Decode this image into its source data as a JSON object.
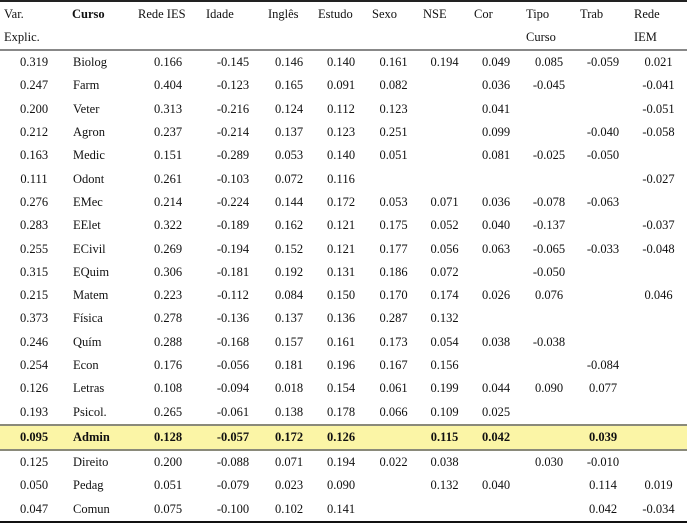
{
  "table": {
    "headers": [
      {
        "line1": "Var.",
        "line2": "Explic."
      },
      {
        "line1": "Curso",
        "line2": ""
      },
      {
        "line1": "Rede IES",
        "line2": ""
      },
      {
        "line1": "Idade",
        "line2": ""
      },
      {
        "line1": "Inglês",
        "line2": ""
      },
      {
        "line1": "Estudo",
        "line2": ""
      },
      {
        "line1": "Sexo",
        "line2": ""
      },
      {
        "line1": "NSE",
        "line2": ""
      },
      {
        "line1": "Cor",
        "line2": ""
      },
      {
        "line1": "Tipo",
        "line2": "Curso"
      },
      {
        "line1": "Trab",
        "line2": ""
      },
      {
        "line1": "Rede",
        "line2": "IEM"
      }
    ],
    "highlight_row_index": 16,
    "highlight_color": "#fbf5a6",
    "rows": [
      [
        "0.319",
        "Biolog",
        "0.166",
        "-0.145",
        "0.146",
        "0.140",
        "0.161",
        "0.194",
        "0.049",
        "0.085",
        "-0.059",
        "0.021"
      ],
      [
        "0.247",
        "Farm",
        "0.404",
        "-0.123",
        "0.165",
        "0.091",
        "0.082",
        "",
        "0.036",
        "-0.045",
        "",
        "-0.041"
      ],
      [
        "0.200",
        "Veter",
        "0.313",
        "-0.216",
        "0.124",
        "0.112",
        "0.123",
        "",
        "0.041",
        "",
        "",
        "-0.051"
      ],
      [
        "0.212",
        "Agron",
        "0.237",
        "-0.214",
        "0.137",
        "0.123",
        "0.251",
        "",
        "0.099",
        "",
        "-0.040",
        "-0.058"
      ],
      [
        "0.163",
        "Medic",
        "0.151",
        "-0.289",
        "0.053",
        "0.140",
        "0.051",
        "",
        "0.081",
        "-0.025",
        "-0.050",
        ""
      ],
      [
        "0.111",
        "Odont",
        "0.261",
        "-0.103",
        "0.072",
        "0.116",
        "",
        "",
        "",
        "",
        "",
        "-0.027"
      ],
      [
        "0.276",
        "EMec",
        "0.214",
        "-0.224",
        "0.144",
        "0.172",
        "0.053",
        "0.071",
        "0.036",
        "-0.078",
        "-0.063",
        ""
      ],
      [
        "0.283",
        "EElet",
        "0.322",
        "-0.189",
        "0.162",
        "0.121",
        "0.175",
        "0.052",
        "0.040",
        "-0.137",
        "",
        "-0.037"
      ],
      [
        "0.255",
        "ECivil",
        "0.269",
        "-0.194",
        "0.152",
        "0.121",
        "0.177",
        "0.056",
        "0.063",
        "-0.065",
        "-0.033",
        "-0.048"
      ],
      [
        "0.315",
        "EQuim",
        "0.306",
        "-0.181",
        "0.192",
        "0.131",
        "0.186",
        "0.072",
        "",
        "-0.050",
        "",
        ""
      ],
      [
        "0.215",
        "Matem",
        "0.223",
        "-0.112",
        "0.084",
        "0.150",
        "0.170",
        "0.174",
        "0.026",
        "0.076",
        "",
        "0.046"
      ],
      [
        "0.373",
        "Física",
        "0.278",
        "-0.136",
        "0.137",
        "0.136",
        "0.287",
        "0.132",
        "",
        "",
        "",
        ""
      ],
      [
        "0.246",
        "Quím",
        "0.288",
        "-0.168",
        "0.157",
        "0.161",
        "0.173",
        "0.054",
        "0.038",
        "-0.038",
        "",
        ""
      ],
      [
        "0.254",
        "Econ",
        "0.176",
        "-0.056",
        "0.181",
        "0.196",
        "0.167",
        "0.156",
        "",
        "",
        "-0.084",
        ""
      ],
      [
        "0.126",
        "Letras",
        "0.108",
        "-0.094",
        "0.018",
        "0.154",
        "0.061",
        "0.199",
        "0.044",
        "0.090",
        "0.077",
        ""
      ],
      [
        "0.193",
        "Psicol.",
        "0.265",
        "-0.061",
        "0.138",
        "0.178",
        "0.066",
        "0.109",
        "0.025",
        "",
        "",
        ""
      ],
      [
        "0.095",
        "Admin",
        "0.128",
        "-0.057",
        "0.172",
        "0.126",
        "",
        "0.115",
        "0.042",
        "",
        "0.039",
        ""
      ],
      [
        "0.125",
        "Direito",
        "0.200",
        "-0.088",
        "0.071",
        "0.194",
        "0.022",
        "0.038",
        "",
        "0.030",
        "-0.010",
        ""
      ],
      [
        "0.050",
        "Pedag",
        "0.051",
        "-0.079",
        "0.023",
        "0.090",
        "",
        "0.132",
        "0.040",
        "",
        "0.114",
        "0.019"
      ],
      [
        "0.047",
        "Comun",
        "0.075",
        "-0.100",
        "0.102",
        "0.141",
        "",
        "",
        "",
        "",
        "0.042",
        "-0.034"
      ]
    ]
  }
}
